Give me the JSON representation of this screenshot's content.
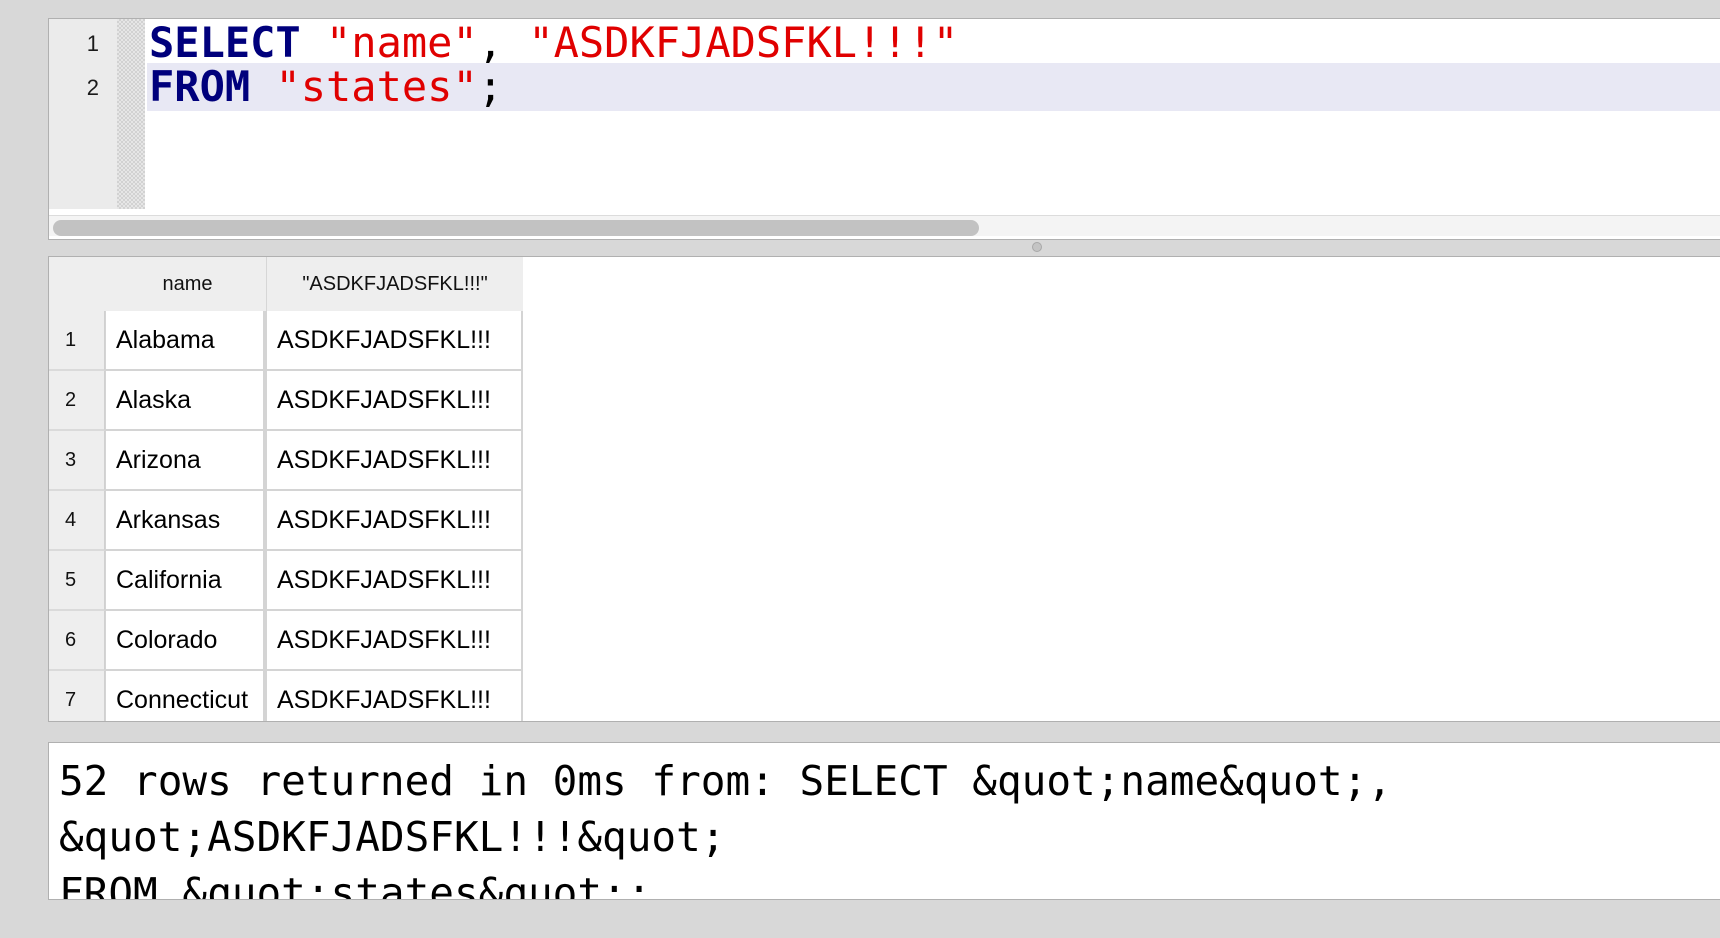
{
  "editor": {
    "lines": [
      {
        "number": "1",
        "tokens": [
          {
            "text": "SELECT",
            "kind": "keyword"
          },
          {
            "text": " ",
            "kind": "space"
          },
          {
            "text": "\"name\"",
            "kind": "string"
          },
          {
            "text": ", ",
            "kind": "punct"
          },
          {
            "text": "\"ASDKFJADSFKL!!!\"",
            "kind": "string"
          }
        ]
      },
      {
        "number": "2",
        "tokens": [
          {
            "text": "FROM",
            "kind": "keyword"
          },
          {
            "text": " ",
            "kind": "space"
          },
          {
            "text": "\"states\"",
            "kind": "string"
          },
          {
            "text": ";",
            "kind": "punct"
          }
        ]
      }
    ],
    "current_line": 2,
    "colors": {
      "keyword": "#00007c",
      "string": "#e00000",
      "current_line_bg": "#e8e8f4"
    }
  },
  "results": {
    "columns": [
      "name",
      "\"ASDKFJADSFKL!!!\""
    ],
    "rows": [
      {
        "num": "1",
        "name": "Alabama",
        "literal": "ASDKFJADSFKL!!!"
      },
      {
        "num": "2",
        "name": "Alaska",
        "literal": "ASDKFJADSFKL!!!"
      },
      {
        "num": "3",
        "name": "Arizona",
        "literal": "ASDKFJADSFKL!!!"
      },
      {
        "num": "4",
        "name": "Arkansas",
        "literal": "ASDKFJADSFKL!!!"
      },
      {
        "num": "5",
        "name": "California",
        "literal": "ASDKFJADSFKL!!!"
      },
      {
        "num": "6",
        "name": "Colorado",
        "literal": "ASDKFJADSFKL!!!"
      },
      {
        "num": "7",
        "name": "Connecticut",
        "literal": "ASDKFJADSFKL!!!"
      }
    ]
  },
  "message": {
    "lines": [
      "52 rows returned in 0ms from: SELECT &quot;name&quot;,",
      "&quot;ASDKFJADSFKL!!!&quot;",
      "FROM &quot;states&quot;;"
    ]
  }
}
